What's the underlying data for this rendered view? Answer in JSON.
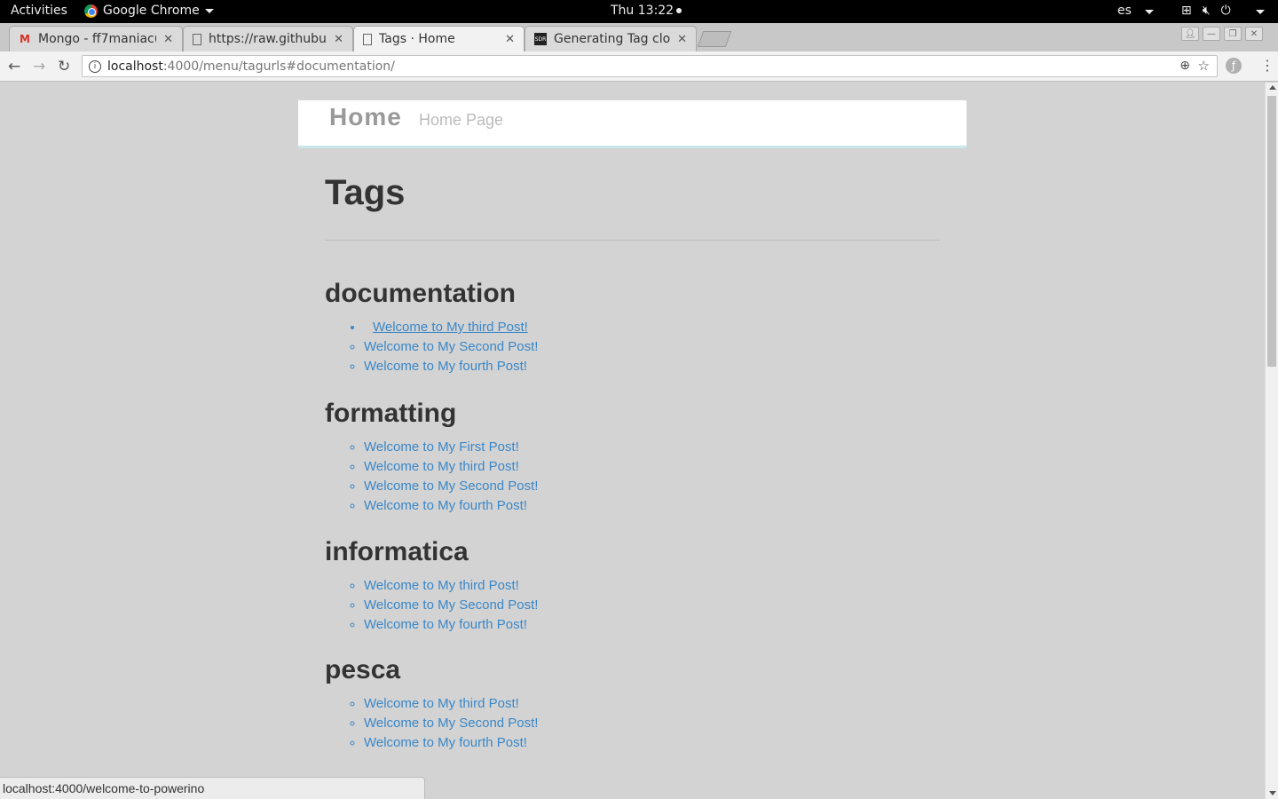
{
  "topbar": {
    "activities": "Activities",
    "app_name": "Google Chrome",
    "clock": "Thu 13:22",
    "language": "es"
  },
  "tabs": [
    {
      "title": "Mongo - ff7maniac(",
      "favicon": "gmail-icon"
    },
    {
      "title": "https://raw.githubus",
      "favicon": "document-icon"
    },
    {
      "title": "Tags · Home",
      "favicon": "document-icon",
      "active": true
    },
    {
      "title": "Generating Tag clou",
      "favicon": "sdr-icon"
    }
  ],
  "toolbar": {
    "url_host": "localhost",
    "url_rest": ":4000/menu/tagurls#documentation/"
  },
  "site": {
    "brand": "Home",
    "tagline": "Home Page"
  },
  "page": {
    "title": "Tags",
    "sections": [
      {
        "tag": "documentation",
        "posts": [
          "Welcome to My third Post!",
          "Welcome to My Second Post!",
          "Welcome to My fourth Post!"
        ]
      },
      {
        "tag": "formatting",
        "posts": [
          "Welcome to My First Post!",
          "Welcome to My third Post!",
          "Welcome to My Second Post!",
          "Welcome to My fourth Post!"
        ]
      },
      {
        "tag": "informatica",
        "posts": [
          "Welcome to My third Post!",
          "Welcome to My Second Post!",
          "Welcome to My fourth Post!"
        ]
      },
      {
        "tag": "pesca",
        "posts": [
          "Welcome to My third Post!",
          "Welcome to My Second Post!",
          "Welcome to My fourth Post!"
        ]
      }
    ]
  },
  "status_bar": {
    "url": "localhost:4000/welcome-to-powerino"
  },
  "colors": {
    "link": "#3a87c8",
    "page_background": "#d3d3d3"
  }
}
